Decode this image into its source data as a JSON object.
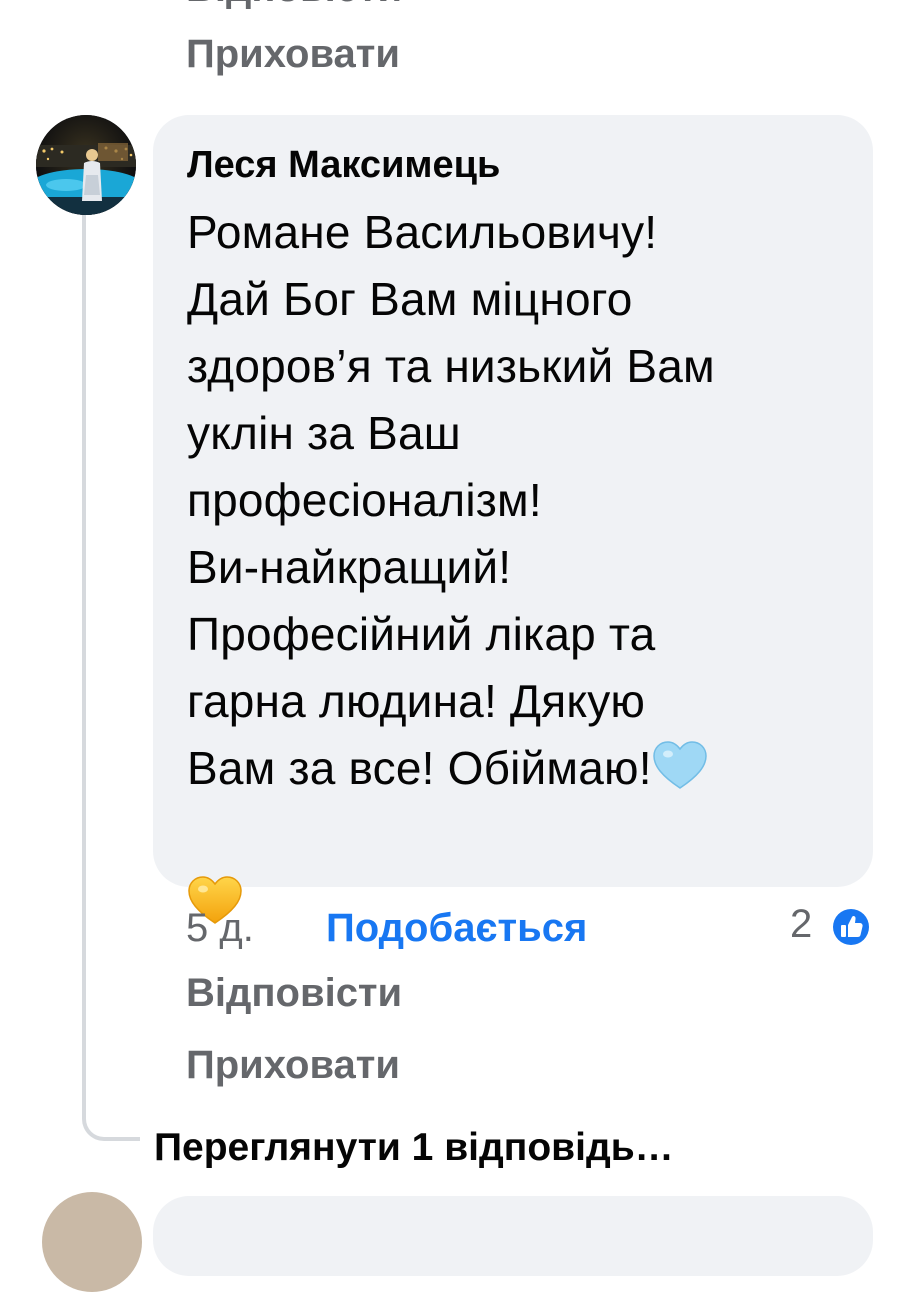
{
  "prev_comment": {
    "reply_label": "Відповісти",
    "hide_label": "Приховати"
  },
  "comment": {
    "author": "Леся Максимець",
    "text": "Романе Васильовичу!\nДай Бог Вам міцного\nздоров’я та низький Вам\nуклін за Ваш\nпрофесіоналізм!\nВи-найкращий!\nПрофесійний лікар та\nгарна людина! Дякую\nВам за все! Обіймаю!",
    "emojis": [
      "light-blue-heart",
      "yellow-heart"
    ],
    "age": "5 д.",
    "like_label": "Подобається",
    "reaction_count": "2",
    "reaction_icon": "like-icon",
    "reply_label": "Відповісти",
    "hide_label": "Приховати"
  },
  "view_replies_label": "Переглянути 1 відповідь…",
  "colors": {
    "bubble": "#f0f2f5",
    "meta_text": "#65676b",
    "link_blue": "#1877f2",
    "thread_line": "#d6d9dd"
  }
}
